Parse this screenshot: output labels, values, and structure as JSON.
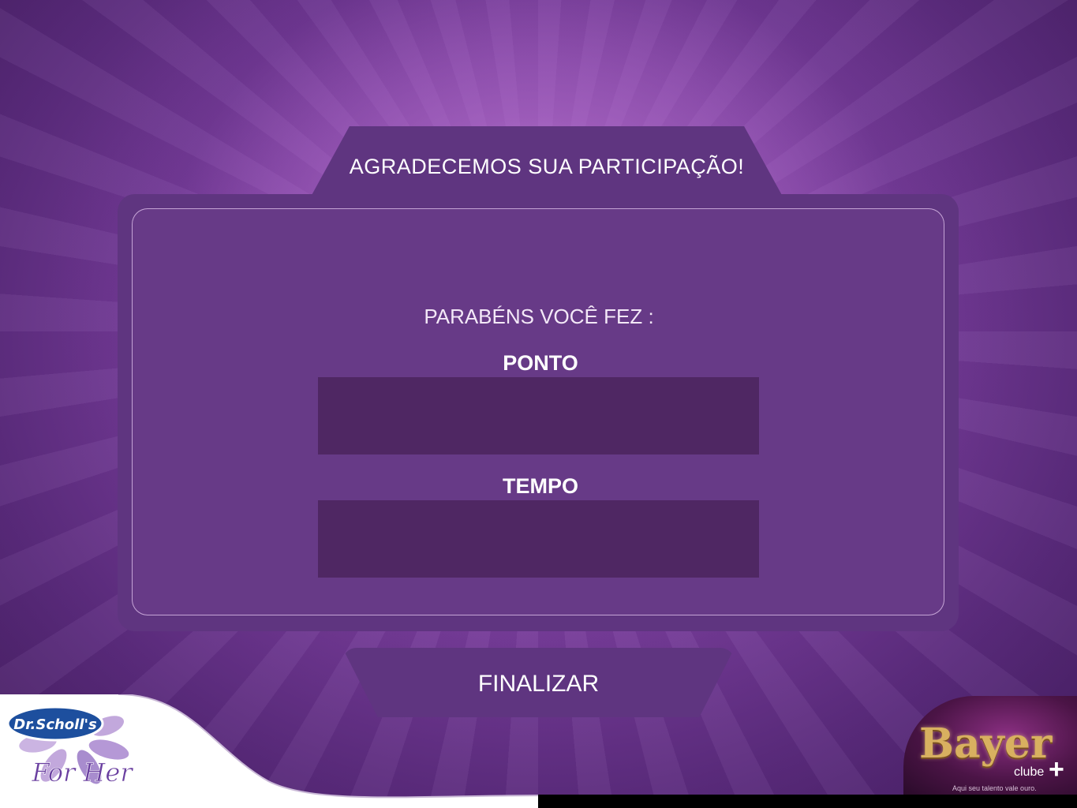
{
  "header": {
    "title": "AGRADECEMOS SUA PARTICIPAÇÃO!"
  },
  "result": {
    "subtitle": "PARABÉNS VOCÊ FEZ :",
    "points_label": "PONTO",
    "points_value": "",
    "time_label": "TEMPO",
    "time_value": ""
  },
  "actions": {
    "finish_label": "FINALIZAR"
  },
  "brands": {
    "left_logo_line1": "Dr.Scholl's",
    "left_logo_line2": "For Her",
    "right_logo_word": "Bayer",
    "right_logo_sub": "clube",
    "right_logo_plus": "+",
    "right_logo_tagline": "Aqui seu talento vale ouro."
  },
  "colors": {
    "panel": "#5f3580",
    "field": "#4f2763",
    "text": "#ffffff"
  }
}
